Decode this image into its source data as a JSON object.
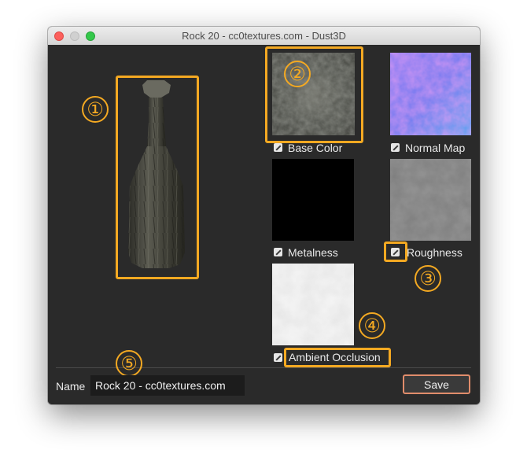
{
  "window": {
    "title": "Rock 20 - cc0textures.com - Dust3D"
  },
  "textures": [
    {
      "label": "Base Color",
      "icon": "pencil-icon"
    },
    {
      "label": "Normal Map",
      "icon": "pencil-icon"
    },
    {
      "label": "Metalness",
      "icon": "pencil-icon"
    },
    {
      "label": "Roughness",
      "icon": "pencil-icon"
    },
    {
      "label": "Ambient Occlusion",
      "icon": "pencil-icon"
    }
  ],
  "callouts": [
    "①",
    "②",
    "③",
    "④",
    "⑤"
  ],
  "name_field": {
    "label": "Name",
    "value": "Rock 20 - cc0textures.com"
  },
  "save_button": {
    "label": "Save"
  },
  "colors": {
    "highlight": "#f4a922",
    "window_bg": "#2a2a2a",
    "save_border": "#e08c6b"
  }
}
